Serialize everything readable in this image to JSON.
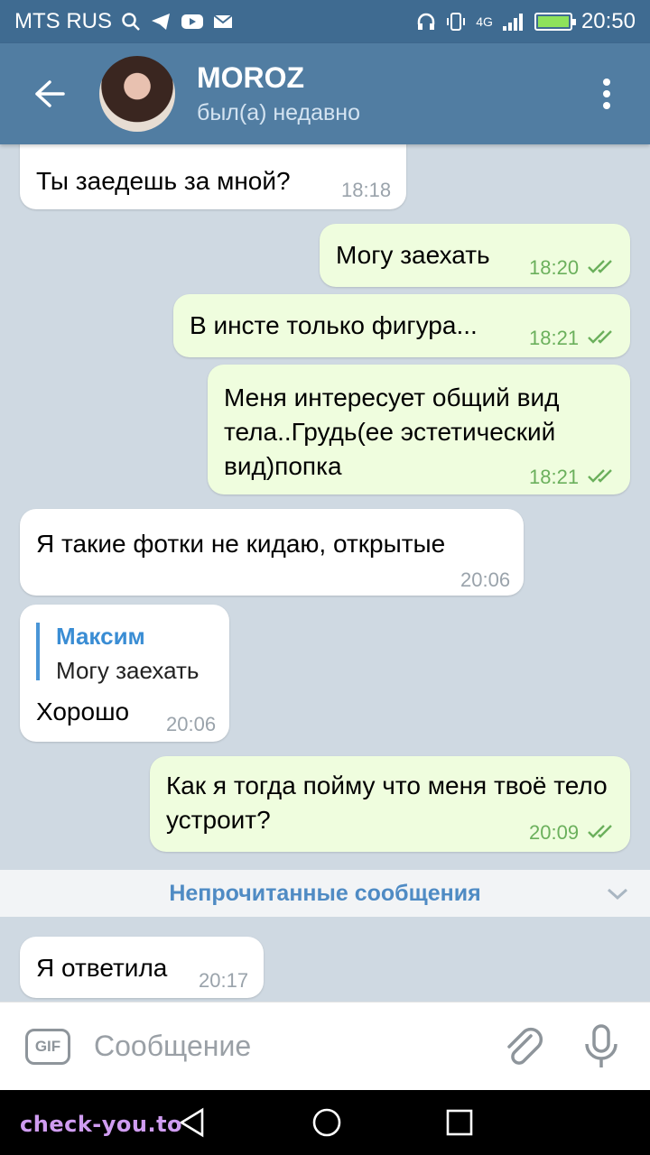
{
  "status_bar": {
    "carrier": "MTS RUS",
    "network": "4G",
    "time": "20:50",
    "battery_level": 1.0
  },
  "header": {
    "contact_name": "MOROZ",
    "contact_status": "был(а) недавно"
  },
  "messages": [
    {
      "direction": "in",
      "text": "Ты заедешь за мной?",
      "time": "18:18"
    },
    {
      "direction": "out",
      "text": "Могу заехать",
      "time": "18:20",
      "read": true
    },
    {
      "direction": "out",
      "text": "В инсте только фигура...",
      "time": "18:21",
      "read": true
    },
    {
      "direction": "out",
      "text": "Меня интересует общий вид тела..Грудь(ее эстетический вид)попка",
      "time": "18:21",
      "read": true
    },
    {
      "direction": "in",
      "text": "Я такие фотки не кидаю, открытые",
      "time": "20:06"
    },
    {
      "direction": "in",
      "reply_to_name": "Максим",
      "reply_to_text": "Могу заехать",
      "text": "Хорошо",
      "time": "20:06"
    },
    {
      "direction": "out",
      "text": "Как я тогда пойму что меня твоё тело устроит?",
      "time": "20:09",
      "read": true
    },
    {
      "direction": "in",
      "text": "Я ответила",
      "time": "20:17"
    }
  ],
  "unread_label": "Непрочитанные сообщения",
  "input": {
    "gif_label": "GIF",
    "placeholder": "Сообщение"
  },
  "watermark": "check-you.to",
  "colors": {
    "header": "#517da2",
    "status_bar": "#3f6b91",
    "incoming_bubble": "#ffffff",
    "outgoing_bubble": "#effdde",
    "accent": "#4f8bc4",
    "read_ticks": "#6bb05c"
  },
  "icons": [
    "back-arrow-icon",
    "more-vert-icon",
    "double-check-icon",
    "chevron-down-icon",
    "gif-icon",
    "paperclip-icon",
    "microphone-icon",
    "nav-back-icon",
    "nav-home-icon",
    "nav-recents-icon"
  ]
}
